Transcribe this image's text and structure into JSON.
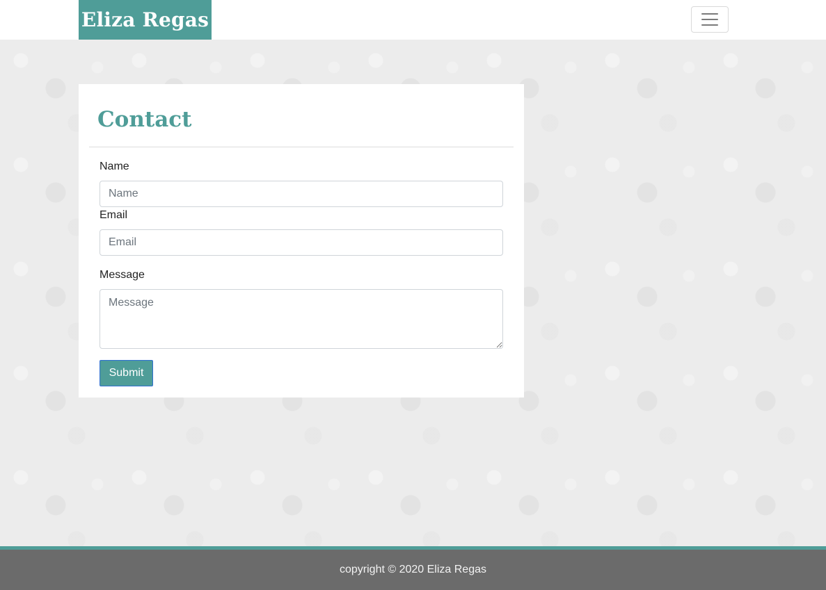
{
  "header": {
    "brand": "Eliza Regas",
    "menu_icon": "hamburger-icon"
  },
  "contact": {
    "title": "Contact",
    "fields": {
      "name_label": "Name",
      "name_placeholder": "Name",
      "name_value": "",
      "email_label": "Email",
      "email_placeholder": "Email",
      "email_value": "",
      "message_label": "Message",
      "message_placeholder": "Message",
      "message_value": ""
    },
    "submit_label": "Submit"
  },
  "footer": {
    "text": "copyright © 2020 Eliza Regas"
  },
  "colors": {
    "accent": "#4f9d98",
    "footer_bg": "#6b6b6b"
  }
}
